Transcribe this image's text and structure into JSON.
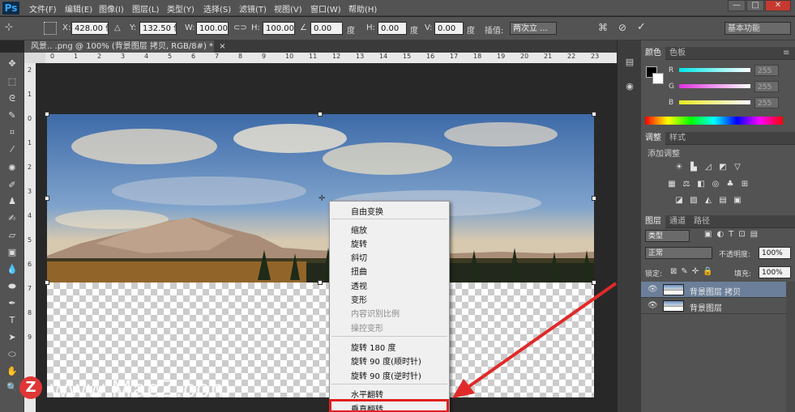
{
  "app": {
    "logo": "Ps"
  },
  "menubar": {
    "items": [
      "文件(F)",
      "编辑(E)",
      "图像(I)",
      "图层(L)",
      "类型(Y)",
      "选择(S)",
      "滤镜(T)",
      "视图(V)",
      "窗口(W)",
      "帮助(H)"
    ],
    "window_buttons": {
      "minimize": "—",
      "maximize": "□",
      "close": "✕"
    }
  },
  "options": {
    "x_label": "X:",
    "x_value": "428.00 像",
    "y_label": "Y:",
    "y_value": "132.50 像",
    "w_label": "W:",
    "w_value": "100.00%",
    "h_label": "H:",
    "h_value": "100.00%",
    "angle_value": "0.00",
    "angle_unit": "度",
    "hskew_label": "H:",
    "hskew_value": "0.00",
    "hskew_unit": "度",
    "vskew_label": "V:",
    "vskew_value": "0.00",
    "vskew_unit": "度",
    "interp_label": "插值:",
    "interp_value": "两次立 ...",
    "workspace": "基本功能"
  },
  "document": {
    "tab_title": "风景..  .png @ 100% (背景图层 拷贝, RGB/8#) *",
    "tab_close": "×"
  },
  "rulers": {
    "h": [
      "0",
      "1",
      "2",
      "3",
      "4",
      "5",
      "6",
      "7",
      "8",
      "9",
      "10",
      "11",
      "12",
      "13",
      "14",
      "15",
      "16",
      "17",
      "18",
      "19",
      "20",
      "21",
      "22",
      "23"
    ],
    "v": [
      "2",
      "1",
      "0",
      "1",
      "2",
      "3",
      "4",
      "5",
      "6",
      "7",
      "8",
      "9"
    ]
  },
  "context_menu": {
    "items": [
      {
        "label": "自由变换",
        "disabled": false
      },
      {
        "label": "缩放",
        "disabled": false
      },
      {
        "label": "旋转",
        "disabled": false
      },
      {
        "label": "斜切",
        "disabled": false
      },
      {
        "label": "扭曲",
        "disabled": false
      },
      {
        "label": "透视",
        "disabled": false
      },
      {
        "label": "变形",
        "disabled": false
      },
      {
        "label": "内容识别比例",
        "disabled": true
      },
      {
        "label": "操控变形",
        "disabled": true
      },
      {
        "label": "旋转 180 度",
        "disabled": false
      },
      {
        "label": "旋转 90 度(顺时针)",
        "disabled": false
      },
      {
        "label": "旋转 90 度(逆时针)",
        "disabled": false
      },
      {
        "label": "水平翻转",
        "disabled": false
      },
      {
        "label": "垂直翻转",
        "disabled": false
      }
    ],
    "highlighted": "垂直翻转"
  },
  "color_panel": {
    "tabs": [
      "颜色",
      "色板"
    ],
    "r_label": "R",
    "g_label": "G",
    "b_label": "B",
    "r_value": "255",
    "g_value": "255",
    "b_value": "255",
    "colors": {
      "r": "#00e5e5",
      "g": "#e030e0",
      "b": "#e8e820"
    }
  },
  "adjust_panel": {
    "tabs": [
      "调整",
      "样式"
    ],
    "title": "添加调整"
  },
  "layers_panel": {
    "tabs": [
      "图层",
      "通道",
      "路径"
    ],
    "filter": "类型",
    "blend_mode": "正常",
    "opacity_label": "不透明度:",
    "opacity_value": "100%",
    "lock_label": "锁定:",
    "fill_label": "填充:",
    "fill_value": "100%",
    "layers": [
      {
        "name": "背景图层 拷贝",
        "selected": true
      },
      {
        "name": "背景图层",
        "selected": false
      }
    ]
  },
  "watermark": {
    "logo": "Z",
    "text": "www.MacZ.com"
  }
}
